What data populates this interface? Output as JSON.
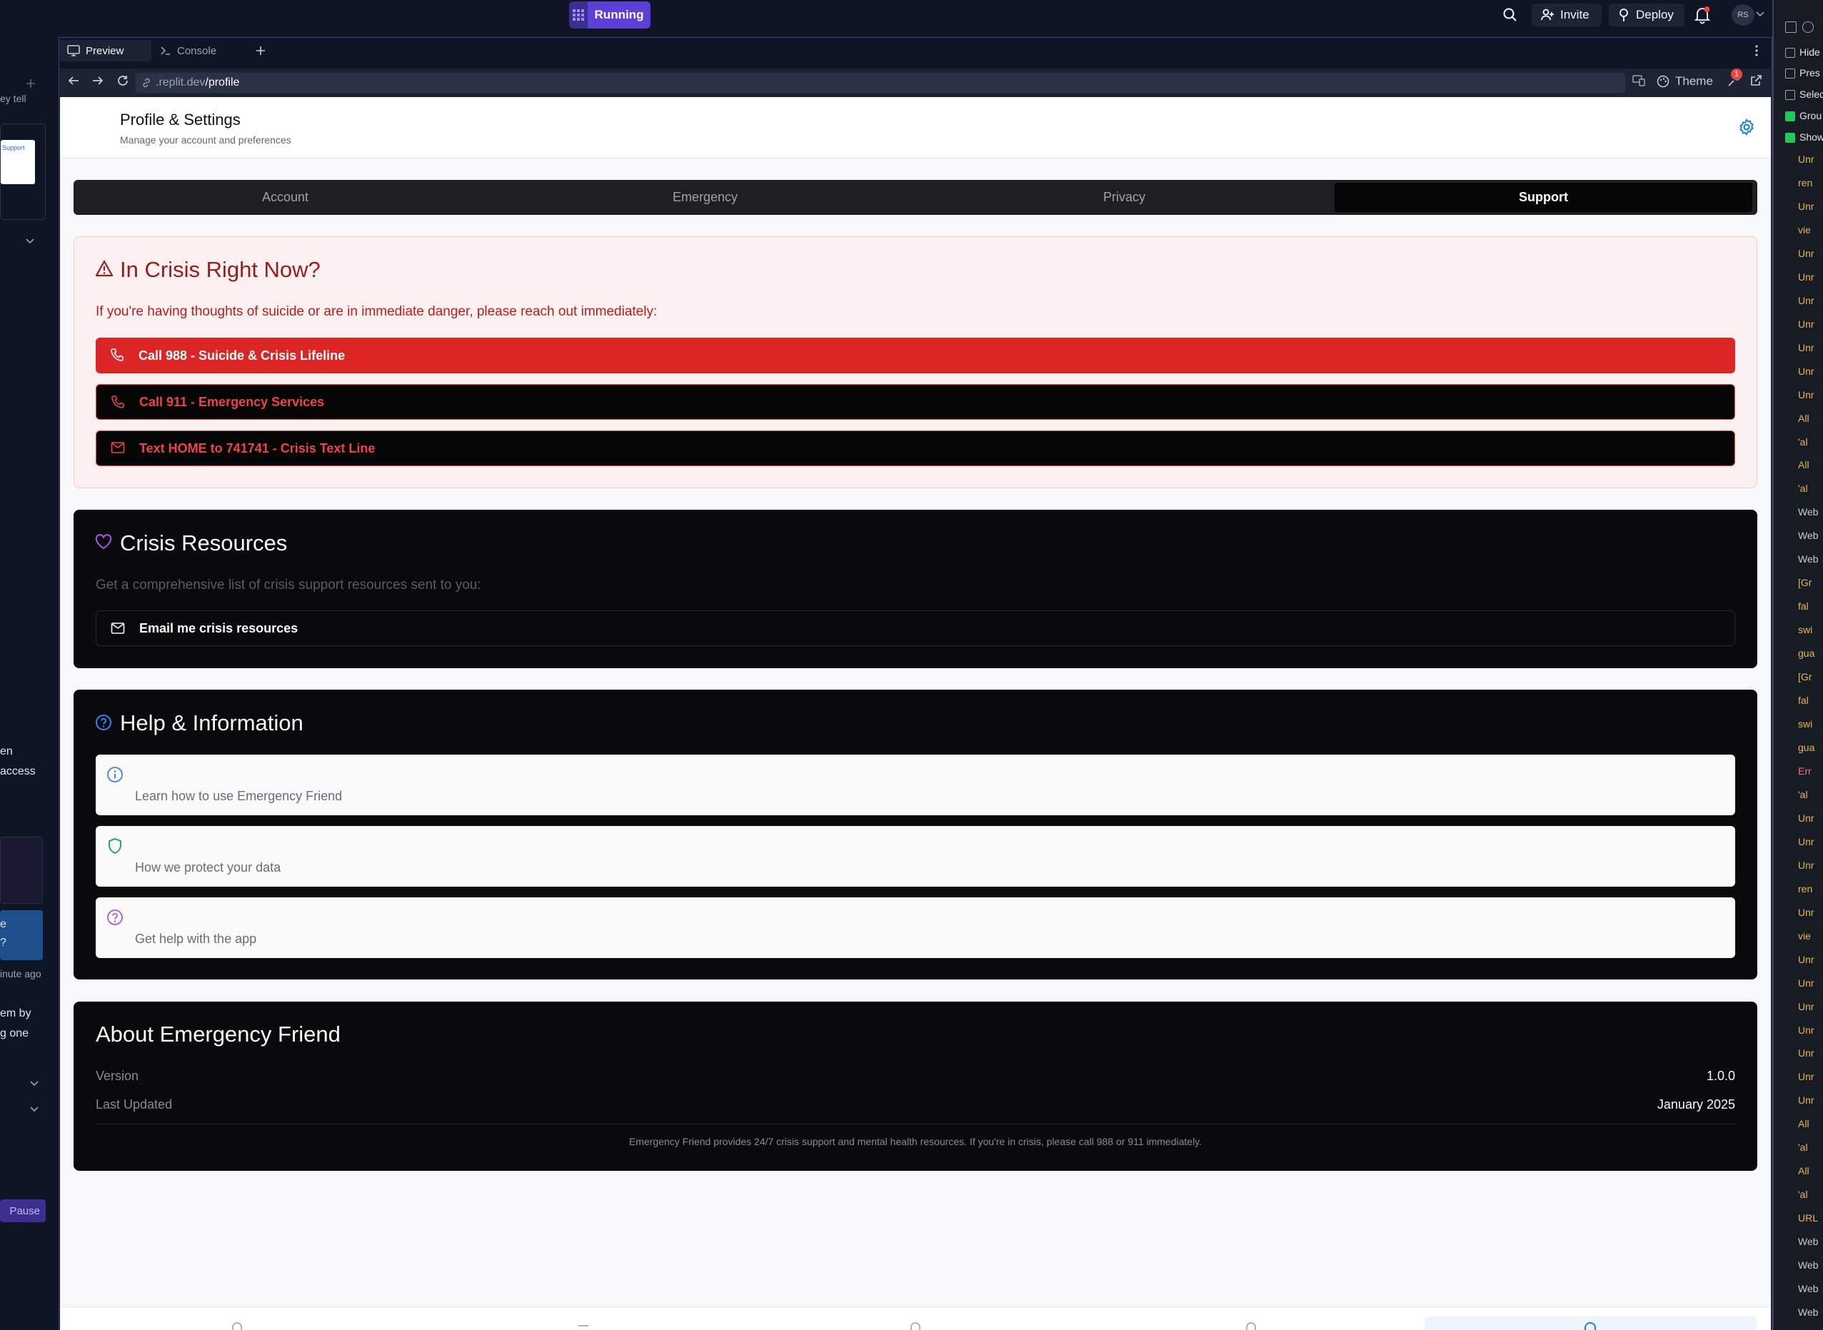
{
  "topbar": {
    "run_label": "Running",
    "invite_label": "Invite",
    "deploy_label": "Deploy",
    "avatar_initials": "RS"
  },
  "left_panel": {
    "snippet_1": "ey tell",
    "thumb_label": "Support",
    "text_a": "en",
    "text_b": "access",
    "chat_line_1": "e",
    "chat_line_2": "?",
    "time_ago": "inute ago",
    "text_c": "em by",
    "text_d": "g one",
    "pause_label": "Pause"
  },
  "workspace": {
    "tabs": [
      {
        "label": "Preview"
      },
      {
        "label": "Console"
      }
    ],
    "url_prefix": ".replit.dev",
    "url_path": "/profile",
    "theme_label": "Theme",
    "badge_count": "1"
  },
  "page": {
    "title": "Profile & Settings",
    "subtitle": "Manage your account and preferences",
    "tabs": [
      {
        "label": "Account"
      },
      {
        "label": "Emergency"
      },
      {
        "label": "Privacy"
      },
      {
        "label": "Support"
      }
    ],
    "active_tab": "Support",
    "crisis": {
      "title": "In Crisis Right Now?",
      "text": "If you're having thoughts of suicide or are in immediate danger, please reach out immediately:",
      "buttons": [
        {
          "label": "Call 988 - Suicide & Crisis Lifeline"
        },
        {
          "label": "Call 911 - Emergency Services"
        },
        {
          "label": "Text HOME to 741741 - Crisis Text Line"
        }
      ]
    },
    "resources": {
      "title": "Crisis Resources",
      "text": "Get a comprehensive list of crisis support resources sent to you:",
      "email_label": "Email me crisis resources"
    },
    "help": {
      "title": "Help & Information",
      "items": [
        {
          "label": "Learn how to use Emergency Friend",
          "icon": "info-icon"
        },
        {
          "label": "How we protect your data",
          "icon": "shield-icon"
        },
        {
          "label": "Get help with the app",
          "icon": "help-circle-icon"
        }
      ]
    },
    "about": {
      "title": "About Emergency Friend",
      "rows": [
        {
          "key": "Version",
          "value": "1.0.0"
        },
        {
          "key": "Last Updated",
          "value": "January 2025"
        }
      ],
      "note": "Emergency Friend provides 24/7 crisis support and mental health resources. If you're in crisis, please call 988 or 911 immediately."
    }
  },
  "devtools": {
    "options": [
      {
        "label": "Hide",
        "checked": false
      },
      {
        "label": "Pres",
        "checked": false
      },
      {
        "label": "Selec",
        "checked": false
      },
      {
        "label": "Grou",
        "checked": true
      },
      {
        "label": "Show",
        "checked": true
      }
    ],
    "log_lines": [
      "Unr",
      "ren",
      "Unr",
      "vie",
      "Unr",
      "Unr",
      "Unr",
      "Unr",
      "Unr",
      "Unr",
      "Unr",
      "All",
      "'al",
      "All",
      "'al",
      "Web",
      "Web",
      "Web",
      "[Gr",
      "fal",
      "swi",
      "gua",
      "[Gr",
      "fal",
      "swi",
      "gua",
      "Err",
      "'al",
      "Unr",
      "Unr",
      "Unr",
      "ren",
      "Unr",
      "vie",
      "Unr",
      "Unr",
      "Unr",
      "Unr",
      "Unr",
      "Unr",
      "Unr",
      "All",
      "'al",
      "All",
      "'al",
      "URL",
      "Web",
      "Web",
      "Web",
      "Web"
    ]
  },
  "colors": {
    "accent": "#5b3fd6",
    "crisis_red": "#dc2626",
    "crisis_text": "#991b1b",
    "card_dark": "#0a0a0c"
  }
}
